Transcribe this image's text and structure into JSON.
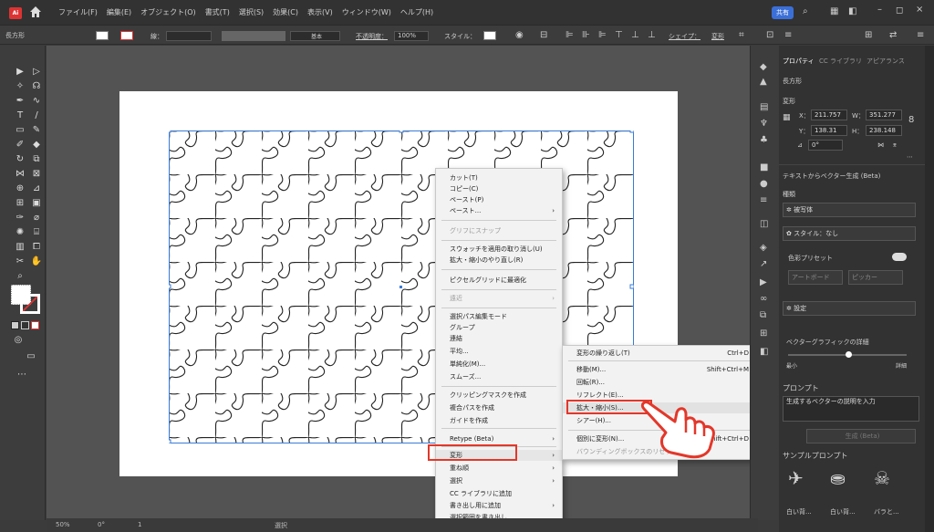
{
  "menubar": {
    "items": [
      "ファイル(F)",
      "編集(E)",
      "オブジェクト(O)",
      "書式(T)",
      "選択(S)",
      "効果(C)",
      "表示(V)",
      "ウィンドウ(W)",
      "ヘルプ(H)"
    ],
    "share": "共有"
  },
  "controlbar": {
    "shape_name": "長方形",
    "stroke_label": "線：",
    "stroke_style": "基本",
    "opacity_label": "不透明度：",
    "opacity_value": "100%",
    "style_label": "スタイル：",
    "shape_label": "シェイプ：",
    "transform_label": "変形"
  },
  "status": {
    "zoom": "50%",
    "rotation": "0°",
    "page": "1",
    "tool": "選択"
  },
  "context_menu": {
    "items": [
      {
        "label": "カット(T)",
        "disabled": false
      },
      {
        "label": "コピー(C)",
        "disabled": false
      },
      {
        "label": "ペースト(P)",
        "disabled": false
      },
      {
        "label": "ペースト...",
        "disabled": false,
        "submenu": true
      },
      {
        "label": "グリフにスナップ",
        "disabled": true
      },
      {
        "label": "スウォッチを適用の取り消し(U)",
        "disabled": false
      },
      {
        "label": "拡大・縮小のやり直し(R)",
        "disabled": false
      },
      {
        "label": "ピクセルグリッドに最適化",
        "disabled": false
      },
      {
        "label": "遠近",
        "disabled": true,
        "submenu": true
      },
      {
        "label": "選択パス編集モード",
        "disabled": false
      },
      {
        "label": "グループ",
        "disabled": false
      },
      {
        "label": "連結",
        "disabled": false
      },
      {
        "label": "平均...",
        "disabled": false
      },
      {
        "label": "単純化(M)...",
        "disabled": false
      },
      {
        "label": "スムーズ...",
        "disabled": false
      },
      {
        "label": "クリッピングマスクを作成",
        "disabled": false
      },
      {
        "label": "複合パスを作成",
        "disabled": false
      },
      {
        "label": "ガイドを作成",
        "disabled": false
      },
      {
        "label": "Retype (Beta)",
        "disabled": false,
        "submenu": true
      },
      {
        "label": "変形",
        "disabled": false,
        "submenu": true
      },
      {
        "label": "重ね順",
        "disabled": false,
        "submenu": true
      },
      {
        "label": "選択",
        "disabled": false,
        "submenu": true
      },
      {
        "label": "CC ライブラリに追加",
        "disabled": false
      },
      {
        "label": "書き出し用に追加",
        "disabled": false,
        "submenu": true
      },
      {
        "label": "選択範囲を書き出し...",
        "disabled": false
      }
    ]
  },
  "submenu": {
    "items": [
      {
        "label": "変形の繰り返し(T)",
        "shortcut": "Ctrl+D"
      },
      {
        "label": "移動(M)...",
        "shortcut": "Shift+Ctrl+M"
      },
      {
        "label": "回転(R)...",
        "shortcut": ""
      },
      {
        "label": "リフレクト(E)...",
        "shortcut": ""
      },
      {
        "label": "拡大・縮小(S)...",
        "shortcut": ""
      },
      {
        "label": "シアー(H)...",
        "shortcut": ""
      },
      {
        "label": "個別に変形(N)...",
        "shortcut": "Alt+Shift+Ctrl+D"
      },
      {
        "label": "バウンディングボックスのリセット",
        "shortcut": "",
        "disabled": true
      }
    ]
  },
  "properties": {
    "tabs": [
      "プロパティ",
      "CC ライブラリ",
      "アピアランス"
    ],
    "object_type": "長方形",
    "transform_label": "変形",
    "x_label": "X：",
    "x_value": "211.757",
    "w_label": "W：",
    "w_value": "351.277",
    "y_label": "Y：",
    "y_value": "138.31",
    "h_label": "H：",
    "h_value": "238.148",
    "angle": "0°",
    "text_to_vector": "テキストからベクター生成 (Beta)",
    "type_label": "種類",
    "type_value": "被写体",
    "style_label": "スタイル：なし",
    "color_preset": "色彩プリセット",
    "artboard_btn": "アートボード",
    "picker_btn": "ピッカー",
    "settings_label": "設定",
    "detail_label": "ベクターグラフィックの詳細",
    "min_label": "最小",
    "max_label": "詳細",
    "prompt_label": "プロンプト",
    "prompt_placeholder": "生成するベクターの説明を入力",
    "generate_btn": "生成 (Beta)",
    "sample_label": "サンプルプロンプト",
    "sample_captions": [
      "白い背...",
      "白い背...",
      "バラと..."
    ]
  },
  "colors": {
    "accent_red": "#e3372a",
    "share_blue": "#3b6fd8",
    "selection_blue": "#3a7bd5"
  }
}
